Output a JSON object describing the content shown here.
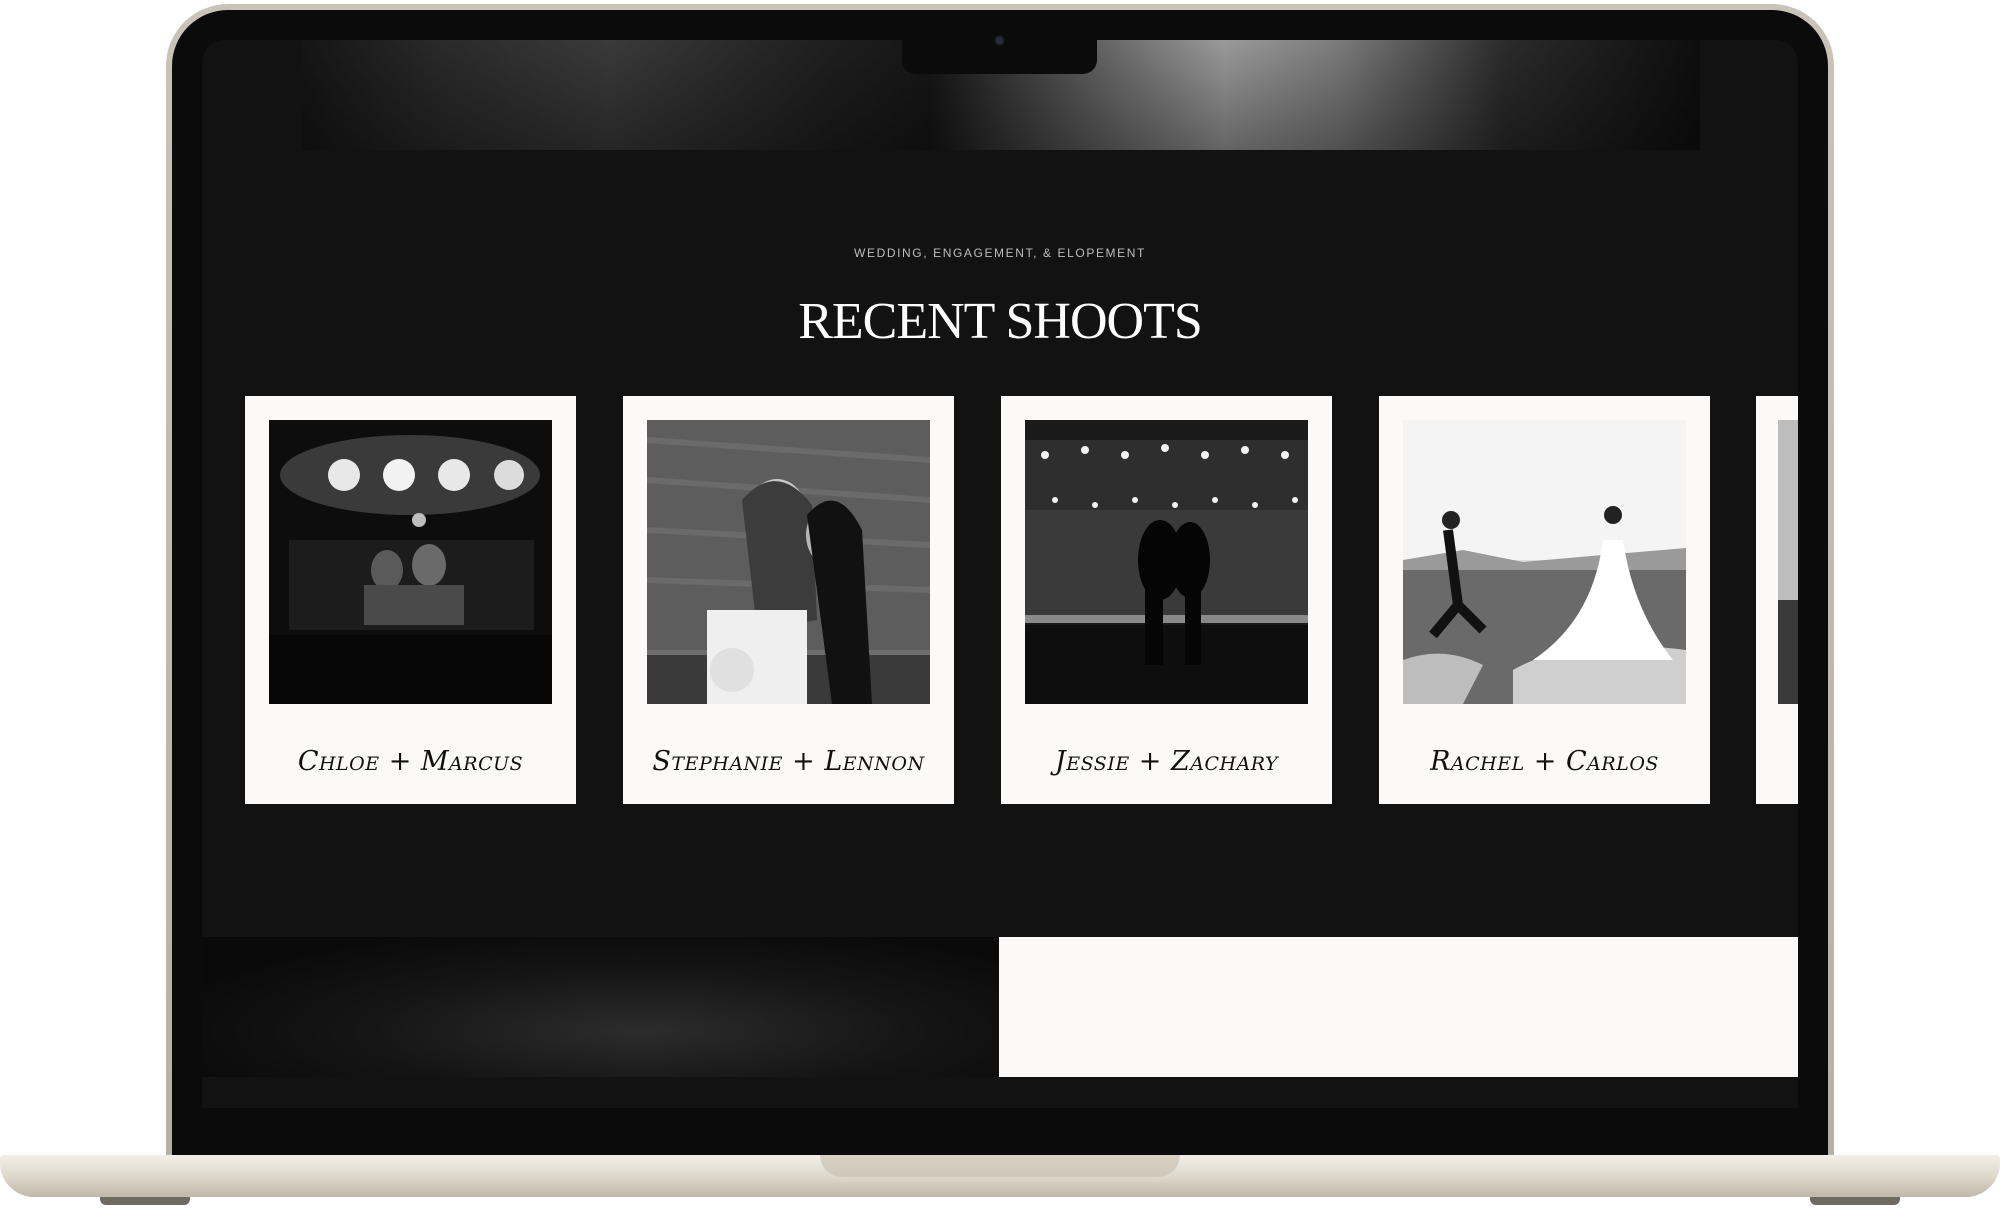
{
  "section": {
    "eyebrow": "WEDDING, ENGAGEMENT, & ELOPEMENT",
    "title": "RECENT SHOOTS"
  },
  "shoots": [
    {
      "couple": "Chloe + Marcus",
      "photo": "couple-in-car-night"
    },
    {
      "couple": "Stephanie + Lennon",
      "photo": "two-brides-embrace"
    },
    {
      "couple": "Jessie + Zachary",
      "photo": "carousel-kiss"
    },
    {
      "couple": "Rachel + Carlos",
      "photo": "rocks-by-sea"
    }
  ],
  "colors": {
    "page_background": "#121212",
    "card_background": "#fbfaf8",
    "title_text": "#ffffff",
    "eyebrow_text": "#bdbdbd",
    "laptop_shell": "#c9c3b8"
  }
}
